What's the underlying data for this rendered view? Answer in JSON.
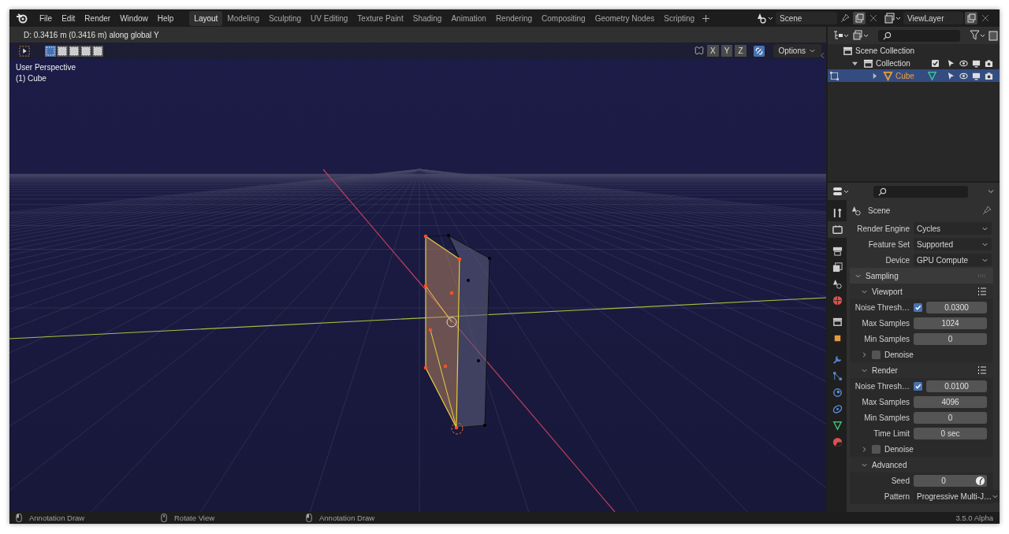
{
  "menu": [
    "File",
    "Edit",
    "Render",
    "Window",
    "Help"
  ],
  "workspaces": [
    {
      "label": "Layout",
      "selected": true
    },
    {
      "label": "Modeling",
      "selected": false
    },
    {
      "label": "Sculpting",
      "selected": false
    },
    {
      "label": "UV Editing",
      "selected": false
    },
    {
      "label": "Texture Paint",
      "selected": false
    },
    {
      "label": "Shading",
      "selected": false
    },
    {
      "label": "Animation",
      "selected": false
    },
    {
      "label": "Rendering",
      "selected": false
    },
    {
      "label": "Compositing",
      "selected": false
    },
    {
      "label": "Geometry Nodes",
      "selected": false
    },
    {
      "label": "Scripting",
      "selected": false
    }
  ],
  "scene_field": {
    "value": "Scene"
  },
  "view_layer_field": {
    "value": "ViewLayer"
  },
  "viewport": {
    "status": "D: 0.3416 m (0.3416 m) along global Y",
    "select_modes": [
      {
        "selected": true
      },
      {
        "selected": false
      },
      {
        "selected": false
      },
      {
        "selected": false
      },
      {
        "selected": false
      }
    ],
    "axes": [
      {
        "label": "X",
        "selected": false
      },
      {
        "label": "Y",
        "selected": false
      },
      {
        "label": "Z",
        "selected": false
      }
    ],
    "options": "Options",
    "overlay": [
      "User Perspective",
      "(1) Cube"
    ]
  },
  "outliner": {
    "items": [
      {
        "label": "Scene Collection",
        "kind": "scene_collection",
        "selected": false,
        "children": [
          {
            "label": "Collection",
            "kind": "collection",
            "selected": false,
            "expanded": true,
            "checked": true,
            "children": [
              {
                "label": "Cube",
                "kind": "mesh_object",
                "selected": true,
                "expanded": false
              }
            ]
          }
        ]
      }
    ]
  },
  "properties": {
    "tabs": [
      {
        "kind": "tool",
        "selected": false
      },
      {
        "kind": "render",
        "selected": true
      },
      {
        "kind": "output",
        "selected": false
      },
      {
        "kind": "view_layer",
        "selected": false
      },
      {
        "kind": "scene",
        "selected": false
      },
      {
        "kind": "world",
        "selected": false
      },
      {
        "kind": "collection",
        "selected": false
      },
      {
        "kind": "object",
        "selected": false
      },
      {
        "kind": "modifiers",
        "selected": false
      },
      {
        "kind": "particles",
        "selected": false
      },
      {
        "kind": "physics",
        "selected": false
      },
      {
        "kind": "constraints",
        "selected": false
      },
      {
        "kind": "data",
        "selected": false
      },
      {
        "kind": "material",
        "selected": false
      }
    ],
    "title": "Scene",
    "rows": [
      {
        "kind": "dropdown",
        "label": "Render Engine",
        "value": "Cycles"
      },
      {
        "kind": "dropdown",
        "label": "Feature Set",
        "value": "Supported"
      },
      {
        "kind": "dropdown",
        "label": "Device",
        "value": "GPU Compute"
      },
      {
        "kind": "panel",
        "label": "Sampling",
        "expanded": true
      },
      {
        "kind": "subpanel",
        "label": "Viewport",
        "expanded": true
      },
      {
        "kind": "toggle_number",
        "label": "Noise Thresh…",
        "checked": true,
        "value": "0.0300"
      },
      {
        "kind": "number",
        "label": "Max Samples",
        "value": "1024"
      },
      {
        "kind": "number",
        "label": "Min Samples",
        "value": "0"
      },
      {
        "kind": "check_subpanel",
        "label": "Denoise",
        "expanded": false,
        "checked": false
      },
      {
        "kind": "subpanel",
        "label": "Render",
        "expanded": true
      },
      {
        "kind": "toggle_number",
        "label": "Noise Thresh…",
        "checked": true,
        "value": "0.0100"
      },
      {
        "kind": "number",
        "label": "Max Samples",
        "value": "4096"
      },
      {
        "kind": "number",
        "label": "Min Samples",
        "value": "0"
      },
      {
        "kind": "number",
        "label": "Time Limit",
        "value": "0 sec"
      },
      {
        "kind": "check_subpanel",
        "label": "Denoise",
        "expanded": false,
        "checked": false
      },
      {
        "kind": "subpanel",
        "label": "Advanced",
        "expanded": true
      },
      {
        "kind": "seed",
        "label": "Seed",
        "value": "0"
      },
      {
        "kind": "dropdown",
        "label": "Pattern",
        "value": "Progressive Multi-J…"
      }
    ]
  },
  "status_bar": {
    "hints": [
      "Annotation Draw",
      "Rotate View",
      "Annotation Draw"
    ],
    "version": "3.5.0 Alpha"
  }
}
